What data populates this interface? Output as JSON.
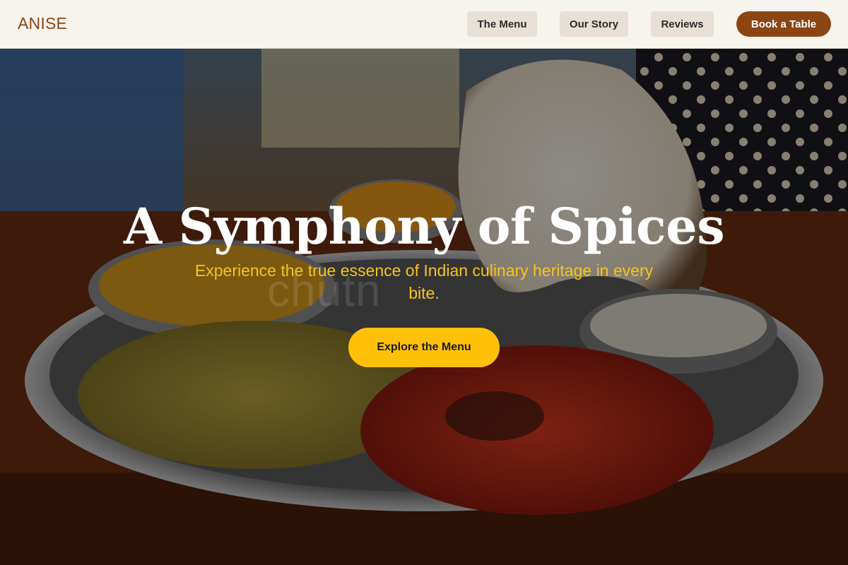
{
  "brand": {
    "name": "ANISE"
  },
  "nav": {
    "items": [
      {
        "label": "The Menu"
      },
      {
        "label": "Our Story"
      },
      {
        "label": "Reviews"
      }
    ],
    "book_label": "Book a Table"
  },
  "hero": {
    "title": "A Symphony of Spices",
    "subtitle": "Experience the true essence of Indian culinary heritage in every bite.",
    "watermark": "chutn",
    "cta_label": "Explore the Menu",
    "image": "thali-plate-photo"
  },
  "colors": {
    "brand": "#8b4513",
    "accent": "#ffc107",
    "subtitle": "#f5c518",
    "header_bg": "#f7f4ee",
    "nav_bg": "#e8e0d6"
  }
}
